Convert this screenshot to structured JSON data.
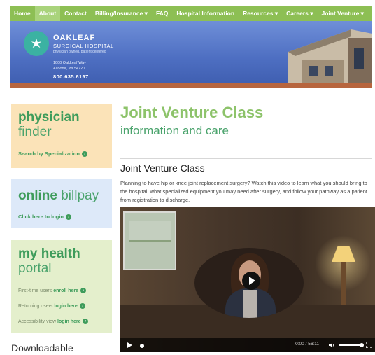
{
  "nav": {
    "items": [
      {
        "label": "Home"
      },
      {
        "label": "About"
      },
      {
        "label": "Contact"
      },
      {
        "label": "Billing/Insurance ▾"
      },
      {
        "label": "FAQ"
      },
      {
        "label": "Hospital Information"
      },
      {
        "label": "Resources ▾"
      },
      {
        "label": "Careers ▾"
      },
      {
        "label": "Joint Venture ▾"
      }
    ],
    "active_index": 1
  },
  "header": {
    "logo_name": "OAKLEAF",
    "logo_sub": "SURGICAL HOSPITAL",
    "tagline": "physician owned, patient centered",
    "address_line1": "1000 OakLeaf Way",
    "address_line2": "Altoona, WI 54720",
    "phone": "800.635.6197"
  },
  "sidebar": {
    "finder": {
      "title_bold": "physician",
      "title_regular": "finder",
      "link": "Search by Specialization"
    },
    "billpay": {
      "title_bold": "online",
      "title_regular": "billpay",
      "link": "Click here to login"
    },
    "health": {
      "title_bold": "my health",
      "title_regular": "portal",
      "rows": [
        {
          "muted": "First-time users",
          "strong": "enroll here"
        },
        {
          "muted": "Returning users",
          "strong": "login here"
        },
        {
          "muted": "Accessibility view",
          "strong": "login here"
        }
      ]
    },
    "downloadable": "Downloadable"
  },
  "main": {
    "title": "Joint Venture Class",
    "subtitle": "information and care",
    "section_title": "Joint Venture Class",
    "paragraph": "Planning to have hip or knee joint replacement surgery? Watch this video to learn what you should bring to the hospital, what specialized equipment you may need after surgery, and follow your pathway as a patient from registration to discharge."
  },
  "video": {
    "time": "0:00 / 56:11",
    "progress_fraction": 0.0
  },
  "colors": {
    "nav_green": "#8dbf54",
    "title_green": "#8dc36a",
    "link_green": "#3e9c5b"
  }
}
